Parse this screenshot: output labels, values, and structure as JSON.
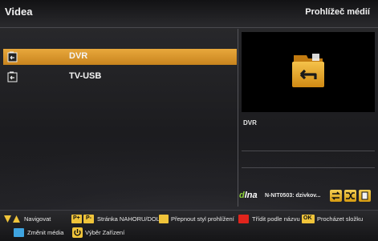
{
  "header": {
    "title": "Videa",
    "section": "Prohlížeč médií"
  },
  "list": {
    "items": [
      {
        "label": "DVR",
        "selected": true
      },
      {
        "label": "TV-USB",
        "selected": false
      }
    ]
  },
  "preview": {
    "device_name": "DVR"
  },
  "dlna": {
    "logo_prefix": "d",
    "logo_rest": "lna",
    "server_info": "N-NIT0503: dzivkov..."
  },
  "legend": {
    "navigate": "Navigovat",
    "page_key_plus": "P+",
    "page_key_minus": "P-",
    "page_label": "Stránka NAHORU/DOLŮ",
    "view_style": "Přepnout styl prohlížení",
    "sort_name": "Třídit podle názvu",
    "ok_key": "OK",
    "browse_folder": "Procházet složku",
    "change_media": "Změnit média",
    "device_select": "Výběr Zařízení"
  },
  "colors": {
    "accent_orange": "#d9952a",
    "key_yellow": "#f0c43a",
    "key_red": "#e0241c",
    "key_blue": "#3fa4e0",
    "dlna_green": "#8ccf3a"
  }
}
